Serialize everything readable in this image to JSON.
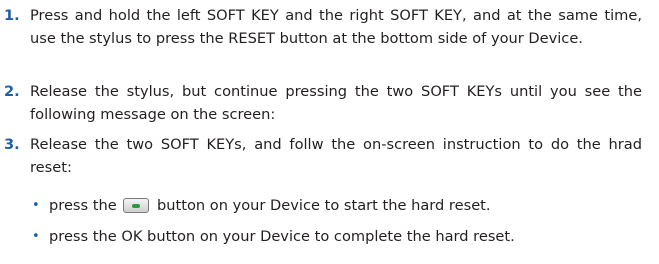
{
  "steps": [
    {
      "number": "1.",
      "text": "Press and hold the left SOFT KEY and the right SOFT KEY, and at the same time, use the stylus to press the RESET button at the bottom side of your Device."
    },
    {
      "number": "2.",
      "text": "Release the stylus, but continue pressing the two SOFT KEYs until you see the following message on the screen:"
    },
    {
      "number": "3.",
      "text": "Release the two SOFT KEYs, and follw the on-screen instruction to do the hrad reset:"
    }
  ],
  "bullets": [
    {
      "marker": "•",
      "before_icon": "press the",
      "icon": "green-phone-key-icon",
      "after_icon": "button on your Device to start the hard reset."
    },
    {
      "marker": "•",
      "text": "press the OK button on your Device to complete the hard reset."
    }
  ],
  "colors": {
    "accent": "#1f5fa3",
    "text": "#231f20",
    "key_icon_green": "#2b9a3c"
  }
}
